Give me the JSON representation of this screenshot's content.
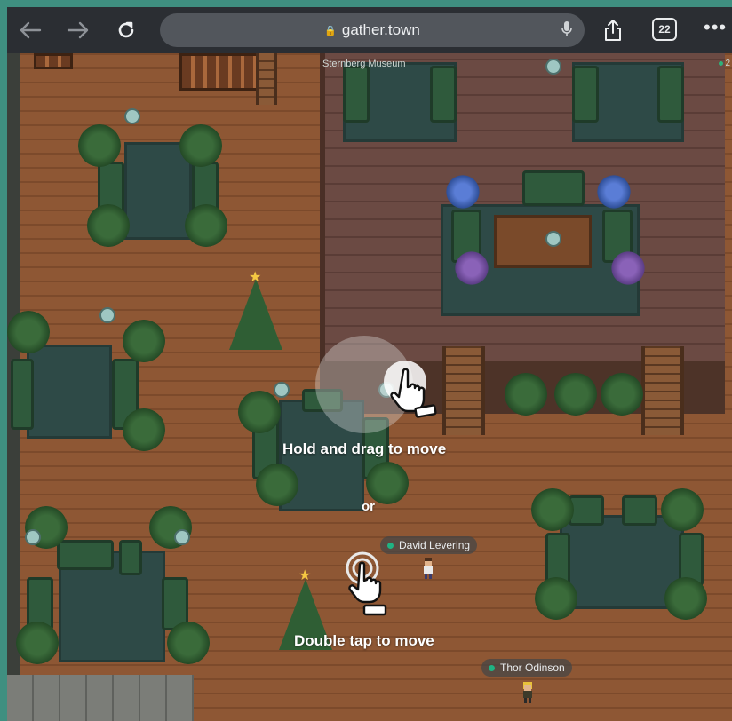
{
  "browser": {
    "url": "gather.town",
    "tab_count": "22"
  },
  "map": {
    "room_label": "Sternberg Museum",
    "online_count": "2"
  },
  "players": [
    {
      "name": "David Levering"
    },
    {
      "name": "Thor Odinson"
    }
  ],
  "tutorial": {
    "drag_hint": "Hold and drag to move",
    "or_label": "or",
    "tap_hint": "Double tap to move"
  },
  "colors": {
    "toolbar": "#2b2e33",
    "frame": "#3f8f80",
    "status_online": "#1fb383"
  }
}
